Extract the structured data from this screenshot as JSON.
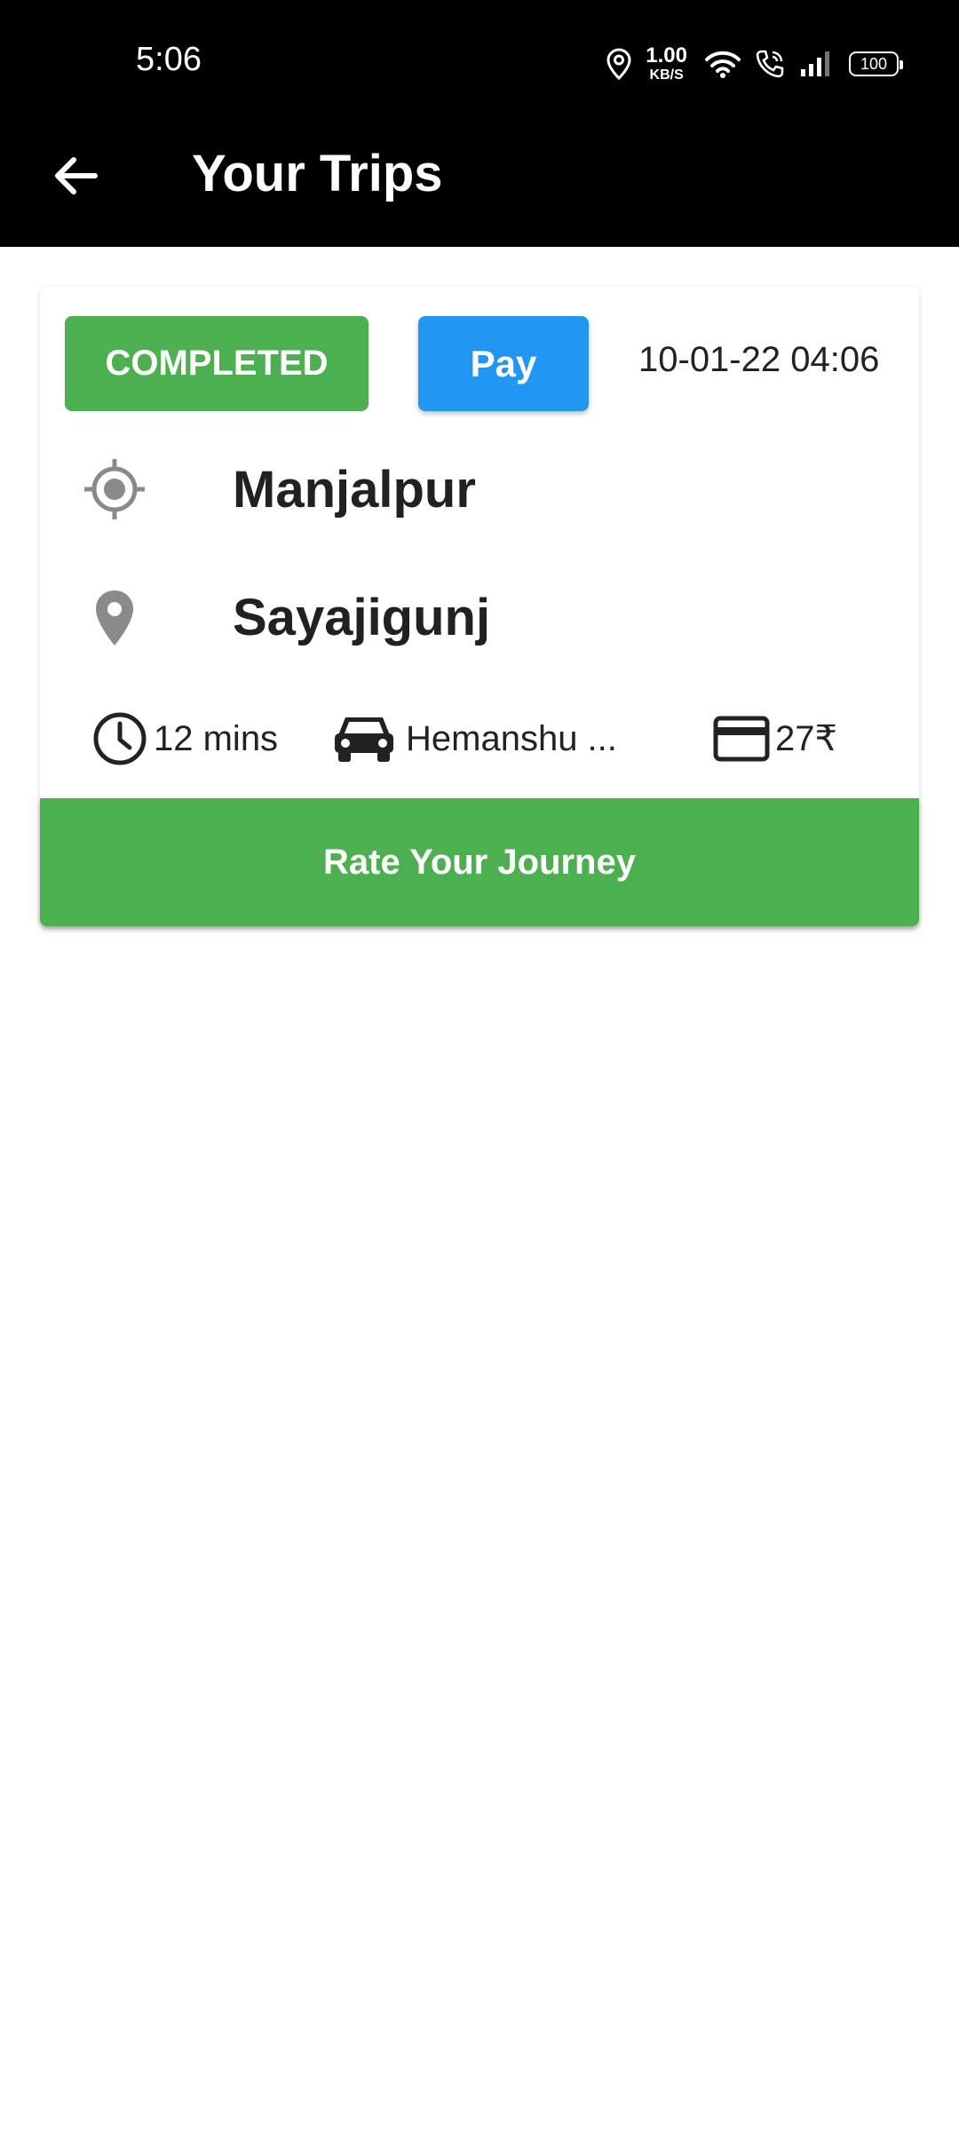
{
  "status_bar": {
    "time": "5:06",
    "net_speed_value": "1.00",
    "net_speed_unit": "KB/S",
    "battery": "100"
  },
  "app_bar": {
    "title": "Your Trips"
  },
  "trip": {
    "status": "COMPLETED",
    "pay_label": "Pay",
    "datetime": "10-01-22 04:06",
    "pickup": "Manjalpur",
    "dropoff": "Sayajigunj",
    "duration": "12 mins",
    "driver": "Hemanshu ...",
    "fare": "27₹",
    "rate_label": "Rate Your Journey"
  },
  "colors": {
    "completed": "#4caf50",
    "pay": "#2196f3",
    "rate": "#4caf50",
    "icon_gray": "#8a8a8a"
  }
}
